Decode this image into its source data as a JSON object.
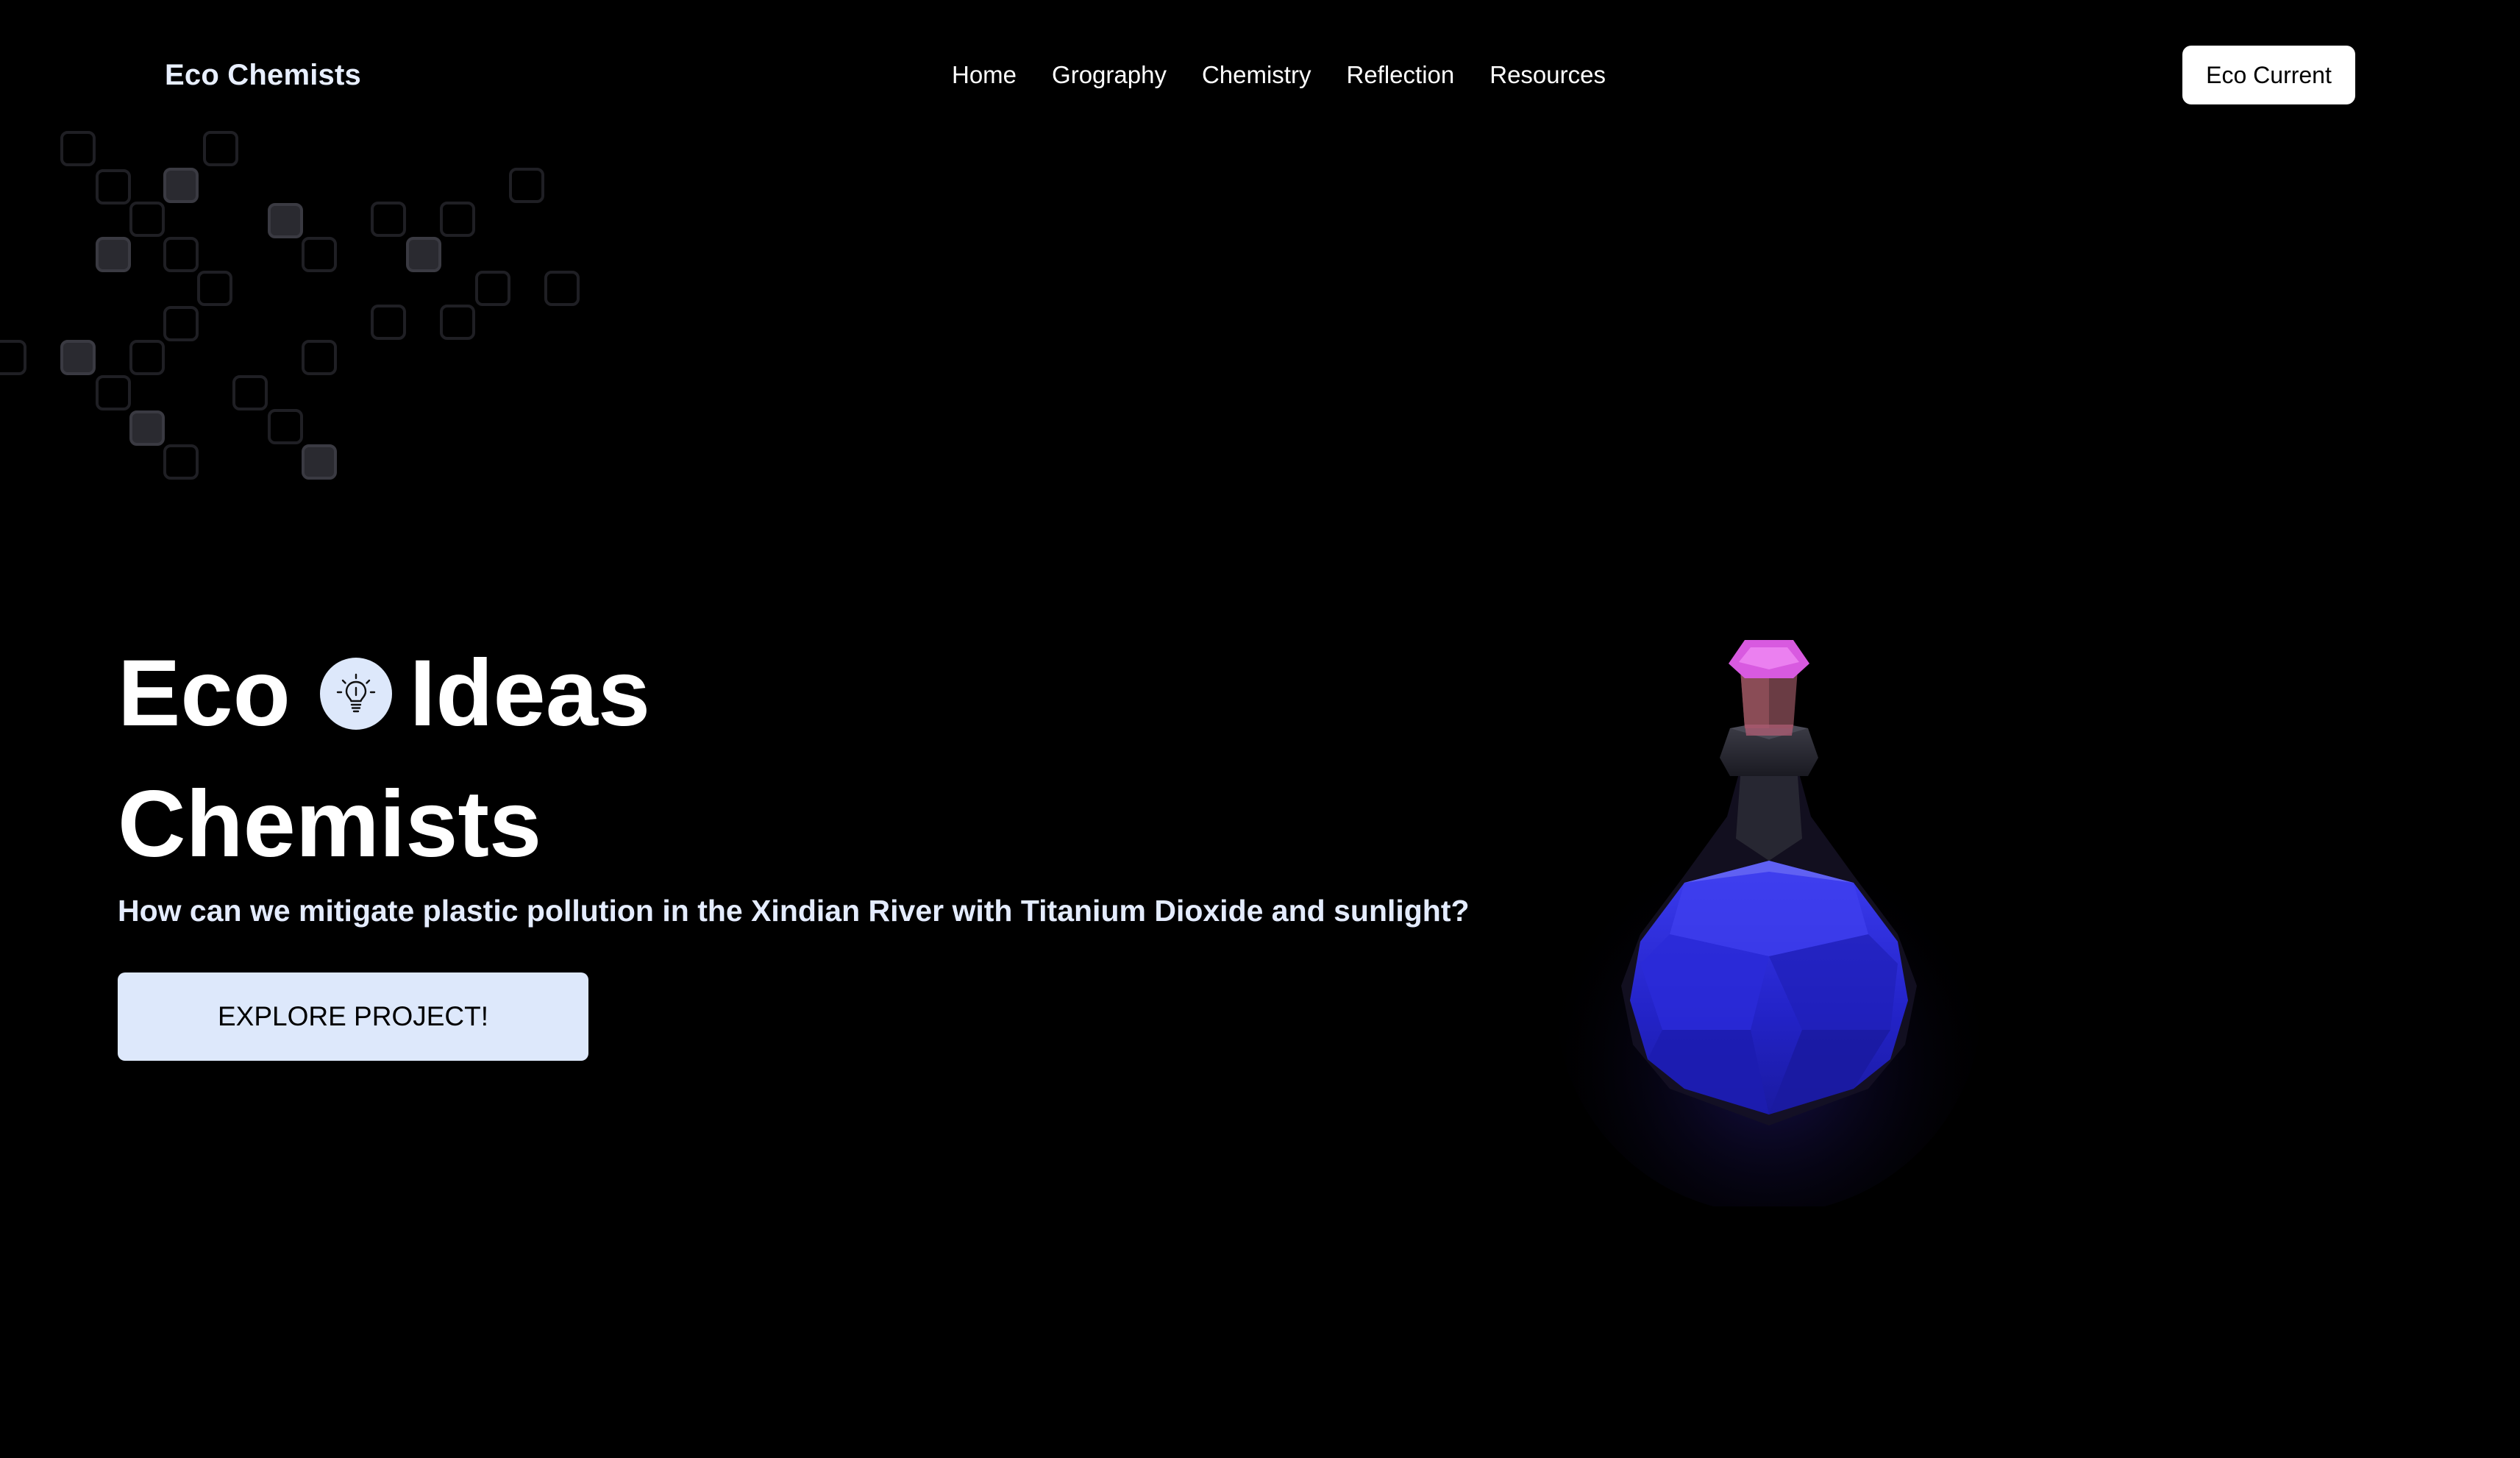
{
  "header": {
    "brand": "Eco Chemists",
    "nav": [
      "Home",
      "Grography",
      "Chemistry",
      "Reflection",
      "Resources"
    ],
    "cta": "Eco Current"
  },
  "hero": {
    "title_word1": "Eco",
    "title_word2": "Ideas",
    "title_line2": "Chemists",
    "subtitle": "How can we mitigate plastic pollution in the Xindian River with Titanium Dioxide and sunlight?",
    "button": "EXPLORE PROJECT!"
  },
  "colors": {
    "background": "#000000",
    "accent_light": "#dde8fb",
    "flask_liquid": "#2a2ee0",
    "flask_cork": "#d85ae0"
  },
  "icons": [
    "lightbulb-icon",
    "potion-flask-illustration"
  ]
}
